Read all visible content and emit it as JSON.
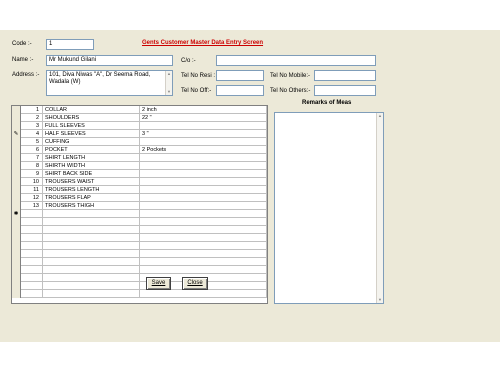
{
  "form": {
    "title": "Gents Customer Master Data Entry Screen",
    "labels": {
      "code": "Code :-",
      "name": "Name :-",
      "address": "Address :-",
      "c_o": "C/o :-",
      "tel_resi": "Tel No Resi :",
      "tel_mobile": "Tel No Mobile:-",
      "tel_off": "Tel No Off:-",
      "tel_others": "Tel No Others:-",
      "remarks": "Remarks of Meas"
    },
    "values": {
      "code": "1",
      "name": "Mr Mukund Gilani",
      "address": "101, Diva Niwas \"A\", Dr Seema Road, Wadala (W)",
      "c_o": "",
      "tel_resi": "",
      "tel_mobile": "",
      "tel_off": "",
      "tel_others": "",
      "remarks": ""
    }
  },
  "grid": {
    "rows": [
      {
        "no": "1",
        "name": "COLLAR",
        "value": "2 inch"
      },
      {
        "no": "2",
        "name": "SHOULDERS",
        "value": "22 \""
      },
      {
        "no": "3",
        "name": "FULL SLEEVES",
        "value": ""
      },
      {
        "no": "4",
        "name": "HALF SLEEVES",
        "value": "3 \""
      },
      {
        "no": "5",
        "name": "CUFFING",
        "value": ""
      },
      {
        "no": "6",
        "name": "POCKET",
        "value": "2 Pockets"
      },
      {
        "no": "7",
        "name": "SHIRT LENGTH",
        "value": ""
      },
      {
        "no": "8",
        "name": "SHIRTH WIDTH",
        "value": ""
      },
      {
        "no": "9",
        "name": "SHIRT BACK SIDE",
        "value": ""
      },
      {
        "no": "10",
        "name": "TROUSERS WAIST",
        "value": ""
      },
      {
        "no": "11",
        "name": "TROUSERS LENGTH",
        "value": ""
      },
      {
        "no": "12",
        "name": "TROUSERS FLAP",
        "value": ""
      },
      {
        "no": "13",
        "name": "TROUSERS THIGH",
        "value": ""
      }
    ],
    "edit_row_marker": "✎",
    "new_row_marker": "✱"
  },
  "buttons": {
    "save": "Save",
    "close": "Close"
  }
}
